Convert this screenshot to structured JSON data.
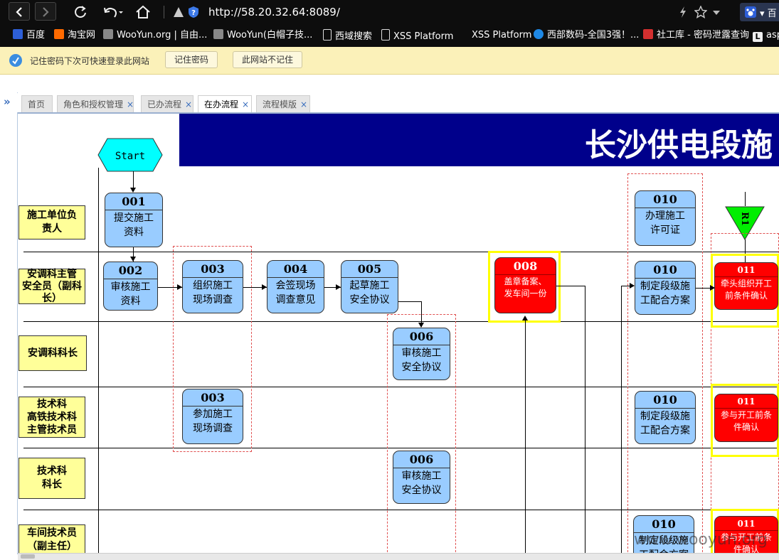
{
  "browser": {
    "url": "http://58.20.32.64:8089/",
    "bookmarks": [
      {
        "label": "百度",
        "color": "#2d5fd8"
      },
      {
        "label": "淘宝网",
        "color": "#ff6a00"
      },
      {
        "label": "WooYun.org | 自由...",
        "color": "#888888"
      },
      {
        "label": "WooYun(白帽子技...",
        "color": "#888888"
      },
      {
        "label": "西域搜索",
        "color": "#dddddd"
      },
      {
        "label": "XSS Platform",
        "color": "#dddddd"
      },
      {
        "label": "XSS Platform",
        "color": "#000000"
      },
      {
        "label": "西部数码-全国3强！...",
        "color": "#1e88e5"
      },
      {
        "label": "社工库 - 密码泄露查询",
        "color": "#d32f2f"
      },
      {
        "label": "asp",
        "color": "#666666"
      }
    ]
  },
  "password_bar": {
    "message": "记住密码下次可快速登录此网站",
    "remember_button": "记住密码",
    "never_button": "此网站不记住"
  },
  "sidebar": {
    "toggle": "»"
  },
  "tabs": [
    {
      "label": "首页",
      "closable": false,
      "active": false
    },
    {
      "label": "角色和授权管理",
      "closable": true,
      "active": false
    },
    {
      "label": "已办流程",
      "closable": true,
      "active": false
    },
    {
      "label": "在办流程",
      "closable": true,
      "active": true
    },
    {
      "label": "流程模版",
      "closable": true,
      "active": false
    }
  ],
  "tab_close": "×",
  "flow": {
    "title": "长沙供电段施",
    "start_label": "Start",
    "r1_label": "R1",
    "watermark": "www.wooyun.org",
    "roles": [
      "施工单位负\n责人",
      "安调科主管\n安全员（副科\n长）",
      "安调科科长",
      "技术科\n高铁技术科\n主管技术员",
      "技术科\n科长",
      "车间技术员\n（副主任）"
    ],
    "nodes": [
      {
        "num": "001",
        "text": "提交施工\n资料"
      },
      {
        "num": "002",
        "text": "审核施工\n资料"
      },
      {
        "num": "003",
        "text": "组织施工\n现场调查"
      },
      {
        "num": "004",
        "text": "会签现场\n调查意见"
      },
      {
        "num": "005",
        "text": "起草施工\n安全协议"
      },
      {
        "num": "006",
        "text": "审核施工\n安全协议"
      },
      {
        "num": "003",
        "text": "参加施工\n现场调查"
      },
      {
        "num": "006",
        "text": "审核施工\n安全协议"
      },
      {
        "num": "008",
        "text": "盖章备案、\n发车间一份"
      },
      {
        "num": "010",
        "text": "办理施工\n许可证"
      },
      {
        "num": "010",
        "text": "制定段级施\n工配合方案"
      },
      {
        "num": "010",
        "text": "制定段级施\n工配合方案"
      },
      {
        "num": "010",
        "text": "制定段级施\n工配合方案"
      },
      {
        "num": "011",
        "text": "牵头组织开工\n前条件确认"
      },
      {
        "num": "011",
        "text": "参与开工前条\n件确认"
      },
      {
        "num": "011",
        "text": "参与开工前条\n件确认"
      }
    ]
  }
}
